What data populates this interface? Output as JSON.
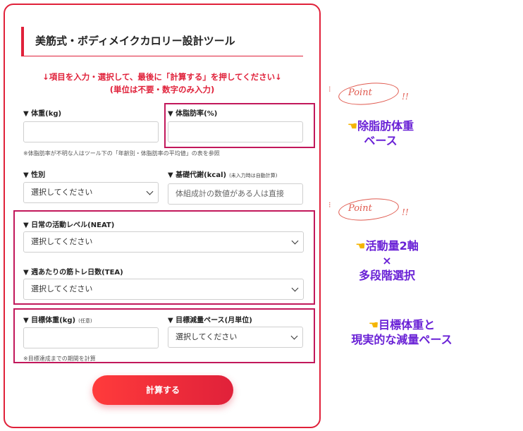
{
  "form": {
    "title": "美筋式・ボディメイクカロリー設計ツール",
    "instruction_line1": "↓項目を入力・選択して、最後に「計算する」を押してください↓",
    "instruction_line2": "(単位は不要・数字のみ入力)",
    "weight_label": "▼ 体重(kg)",
    "bodyfat_label": "▼ 体脂肪率(%)",
    "bodyfat_note": "※体脂肪率が不明な人はツール下の「年齢別・体脂肪率の平均値」の表を参照",
    "sex_label": "▼ 性別",
    "sex_value": "選択してください",
    "bmr_label": "▼ 基礎代謝(kcal)",
    "bmr_sublabel": "(未入力時は自動計算)",
    "bmr_placeholder": "体組成計の数値がある人は直接",
    "neat_label": "▼ 日常の活動レベル(NEAT)",
    "neat_value": "選択してください",
    "tea_label": "▼ 週あたりの筋トレ日数(TEA)",
    "tea_value": "選択してください",
    "target_weight_label": "▼ 目標体重(kg)",
    "target_weight_sublabel": "(任意)",
    "target_note": "※目標達成までの期間を計算",
    "pace_label": "▼ 目標減量ペース(月単位)",
    "pace_value": "選択してください",
    "calculate_label": "計算する"
  },
  "annotations": {
    "point_word": "Point",
    "point_bang": "!!",
    "bodyfat_note_line1": "除脂肪体重",
    "bodyfat_note_line2": "ベース",
    "activity_line1": "活動量2軸",
    "activity_line2": "×",
    "activity_line3": "多段階選択",
    "goal_line1": "目標体重と",
    "goal_line2": "現実的な減量ペース",
    "hand_icon": "☚"
  },
  "colors": {
    "accent_red": "#e0213a",
    "highlight_magenta": "#c2185b",
    "annotation_purple": "#6a22d6",
    "point_coral": "#e05a4f"
  }
}
